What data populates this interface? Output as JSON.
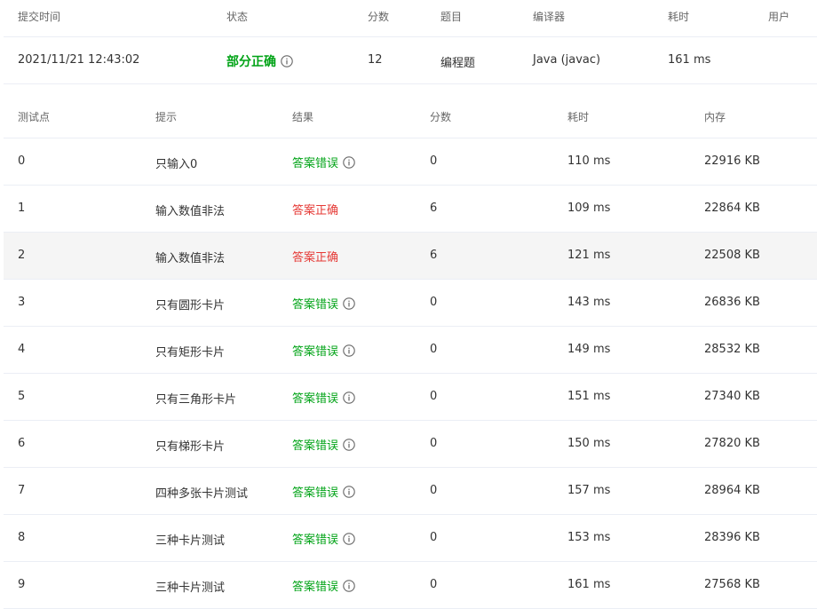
{
  "summary": {
    "headers": {
      "time": "提交时间",
      "status": "状态",
      "score": "分数",
      "problem": "题目",
      "compiler": "编译器",
      "elapsed": "耗时",
      "user": "用户"
    },
    "row": {
      "time": "2021/11/21 12:43:02",
      "status": "部分正确",
      "score": "12",
      "problem": "编程题",
      "compiler": "Java (javac)",
      "elapsed": "161 ms",
      "user": ""
    }
  },
  "tests": {
    "headers": {
      "point": "测试点",
      "hint": "提示",
      "result": "结果",
      "score": "分数",
      "elapsed": "耗时",
      "memory": "内存"
    },
    "rows": [
      {
        "point": "0",
        "hint": "只输入0",
        "result": "答案错误",
        "score": "0",
        "elapsed": "110 ms",
        "memory": "22916 KB"
      },
      {
        "point": "1",
        "hint": "输入数值非法",
        "result": "答案正确",
        "score": "6",
        "elapsed": "109 ms",
        "memory": "22864 KB"
      },
      {
        "point": "2",
        "hint": "输入数值非法",
        "result": "答案正确",
        "score": "6",
        "elapsed": "121 ms",
        "memory": "22508 KB"
      },
      {
        "point": "3",
        "hint": "只有圆形卡片",
        "result": "答案错误",
        "score": "0",
        "elapsed": "143 ms",
        "memory": "26836 KB"
      },
      {
        "point": "4",
        "hint": "只有矩形卡片",
        "result": "答案错误",
        "score": "0",
        "elapsed": "149 ms",
        "memory": "28532 KB"
      },
      {
        "point": "5",
        "hint": "只有三角形卡片",
        "result": "答案错误",
        "score": "0",
        "elapsed": "151 ms",
        "memory": "27340 KB"
      },
      {
        "point": "6",
        "hint": "只有梯形卡片",
        "result": "答案错误",
        "score": "0",
        "elapsed": "150 ms",
        "memory": "27820 KB"
      },
      {
        "point": "7",
        "hint": "四种多张卡片测试",
        "result": "答案错误",
        "score": "0",
        "elapsed": "157 ms",
        "memory": "28964 KB"
      },
      {
        "point": "8",
        "hint": "三种卡片测试",
        "result": "答案错误",
        "score": "0",
        "elapsed": "153 ms",
        "memory": "28396 KB"
      },
      {
        "point": "9",
        "hint": "三种卡片测试",
        "result": "答案错误",
        "score": "0",
        "elapsed": "161 ms",
        "memory": "27568 KB"
      }
    ]
  },
  "colors": {
    "accepted": "#e53935",
    "wrong": "#00a316",
    "partial": "#00a316"
  },
  "icons": {
    "info": "info-circle-icon"
  }
}
